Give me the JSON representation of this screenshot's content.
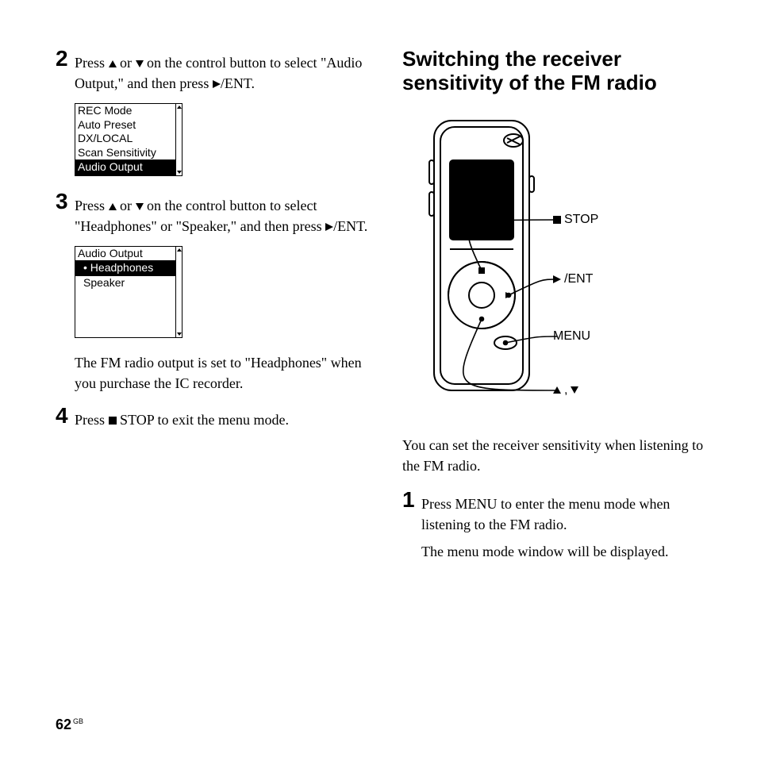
{
  "left": {
    "steps": {
      "s2": {
        "num": "2",
        "text_a": "Press ",
        "text_b": " or ",
        "text_c": " on the control button to select \"Audio Output,\" and then press ",
        "text_d": "/ENT."
      },
      "s3": {
        "num": "3",
        "text_a": "Press ",
        "text_b": " or ",
        "text_c": " on the control button to select \"Headphones\" or \"Speaker,\" and then press ",
        "text_d": "/ENT."
      },
      "s4": {
        "num": "4",
        "text_a": "Press ",
        "text_b": " STOP to exit the menu mode."
      }
    },
    "menu1": {
      "items": [
        "REC Mode",
        "Auto Preset",
        "DX/LOCAL",
        "Scan Sensitivity",
        "Audio Output"
      ],
      "selected": 4
    },
    "menu2": {
      "title": "Audio Output",
      "items": [
        "Headphones",
        "Speaker"
      ],
      "selected": 0
    },
    "note": "The FM radio output is set to \"Headphones\" when you purchase the IC recorder."
  },
  "right": {
    "title": "Switching the receiver sensitivity of the FM radio",
    "callouts": {
      "stop": " STOP",
      "ent": "/ENT",
      "menu": "MENU",
      "arrows_sep": ", "
    },
    "intro": "You can set the receiver sensitivity when listening to the FM radio.",
    "steps": {
      "s1": {
        "num": "1",
        "text": "Press MENU to enter the menu mode when listening to the FM radio.",
        "after": "The menu mode window will be displayed."
      }
    }
  },
  "page_number": "62",
  "page_region": "GB"
}
